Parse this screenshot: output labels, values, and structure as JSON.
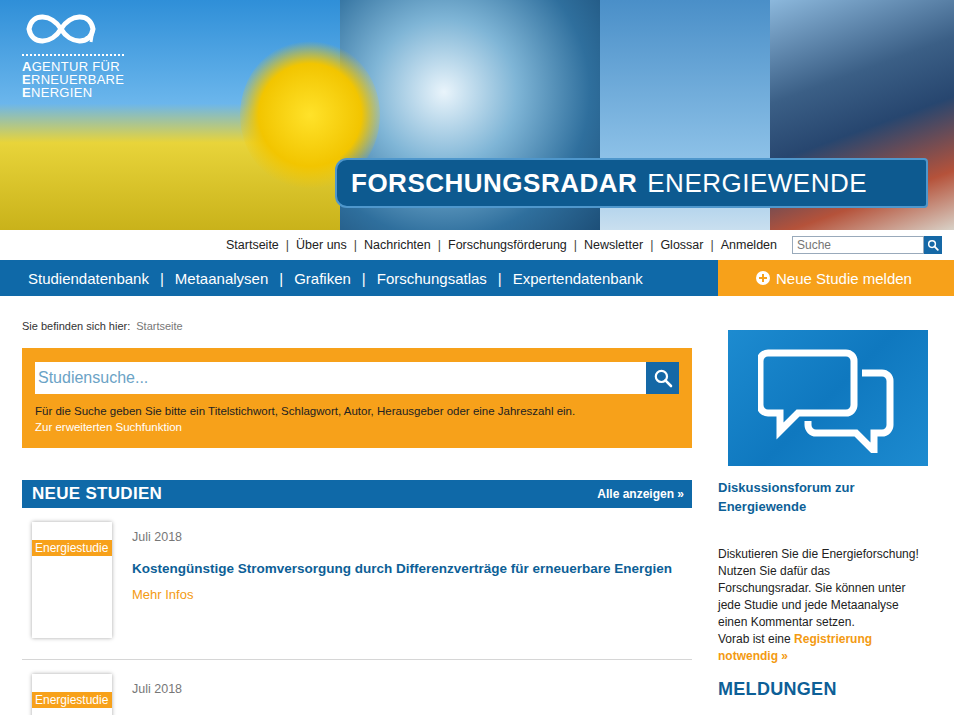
{
  "logo": {
    "lines": [
      {
        "initial": "A",
        "rest": "GENTUR FÜR"
      },
      {
        "initial": "E",
        "rest": "RNEUERBARE"
      },
      {
        "initial": "E",
        "rest": "NERGIEN"
      }
    ]
  },
  "banner_title": {
    "bold": "FORSCHUNGSRADAR",
    "light": "ENERGIEWENDE"
  },
  "top_nav": {
    "items": [
      "Startseite",
      "Über uns",
      "Nachrichten",
      "Forschungsförderung",
      "Newsletter",
      "Glossar",
      "Anmelden"
    ],
    "separator": "|"
  },
  "top_search": {
    "placeholder": "Suche"
  },
  "main_nav": {
    "items": [
      "Studiendatenbank",
      "Metaanalysen",
      "Grafiken",
      "Forschungsatlas",
      "Expertendatenbank"
    ],
    "separator": "|"
  },
  "report_button": {
    "label": "Neue Studie melden"
  },
  "breadcrumb": {
    "label": "Sie befinden sich hier:",
    "items": [
      "Startseite"
    ]
  },
  "study_search": {
    "placeholder": "Studiensuche...",
    "hint": "Für die Suche geben Sie bitte ein Titelstichwort, Schlagwort, Autor, Herausgeber oder eine Jahreszahl ein.",
    "advanced_link": "Zur erweiterten Suchfunktion"
  },
  "new_studies": {
    "title": "NEUE STUDIEN",
    "all_link": "Alle anzeigen »",
    "items": [
      {
        "tag": "Energiestudie",
        "date": "Juli 2018",
        "title": "Kostengünstige Stromversorgung durch Differenzverträge für erneuerbare Energien",
        "more": "Mehr Infos"
      },
      {
        "tag": "Energiestudie",
        "date": "Juli 2018"
      }
    ]
  },
  "sidebar": {
    "forum_title": "Diskussionsforum zur Energiewende",
    "forum_text": "Diskutieren Sie die Energieforschung! Nutzen Sie dafür das Forschungsradar. Sie können unter jede Studie und jede Metaanalyse einen Kommentar setzen.",
    "forum_note": "Vorab ist eine ",
    "forum_link": "Registrierung notwendig »",
    "news_title": "MELDUNGEN"
  }
}
